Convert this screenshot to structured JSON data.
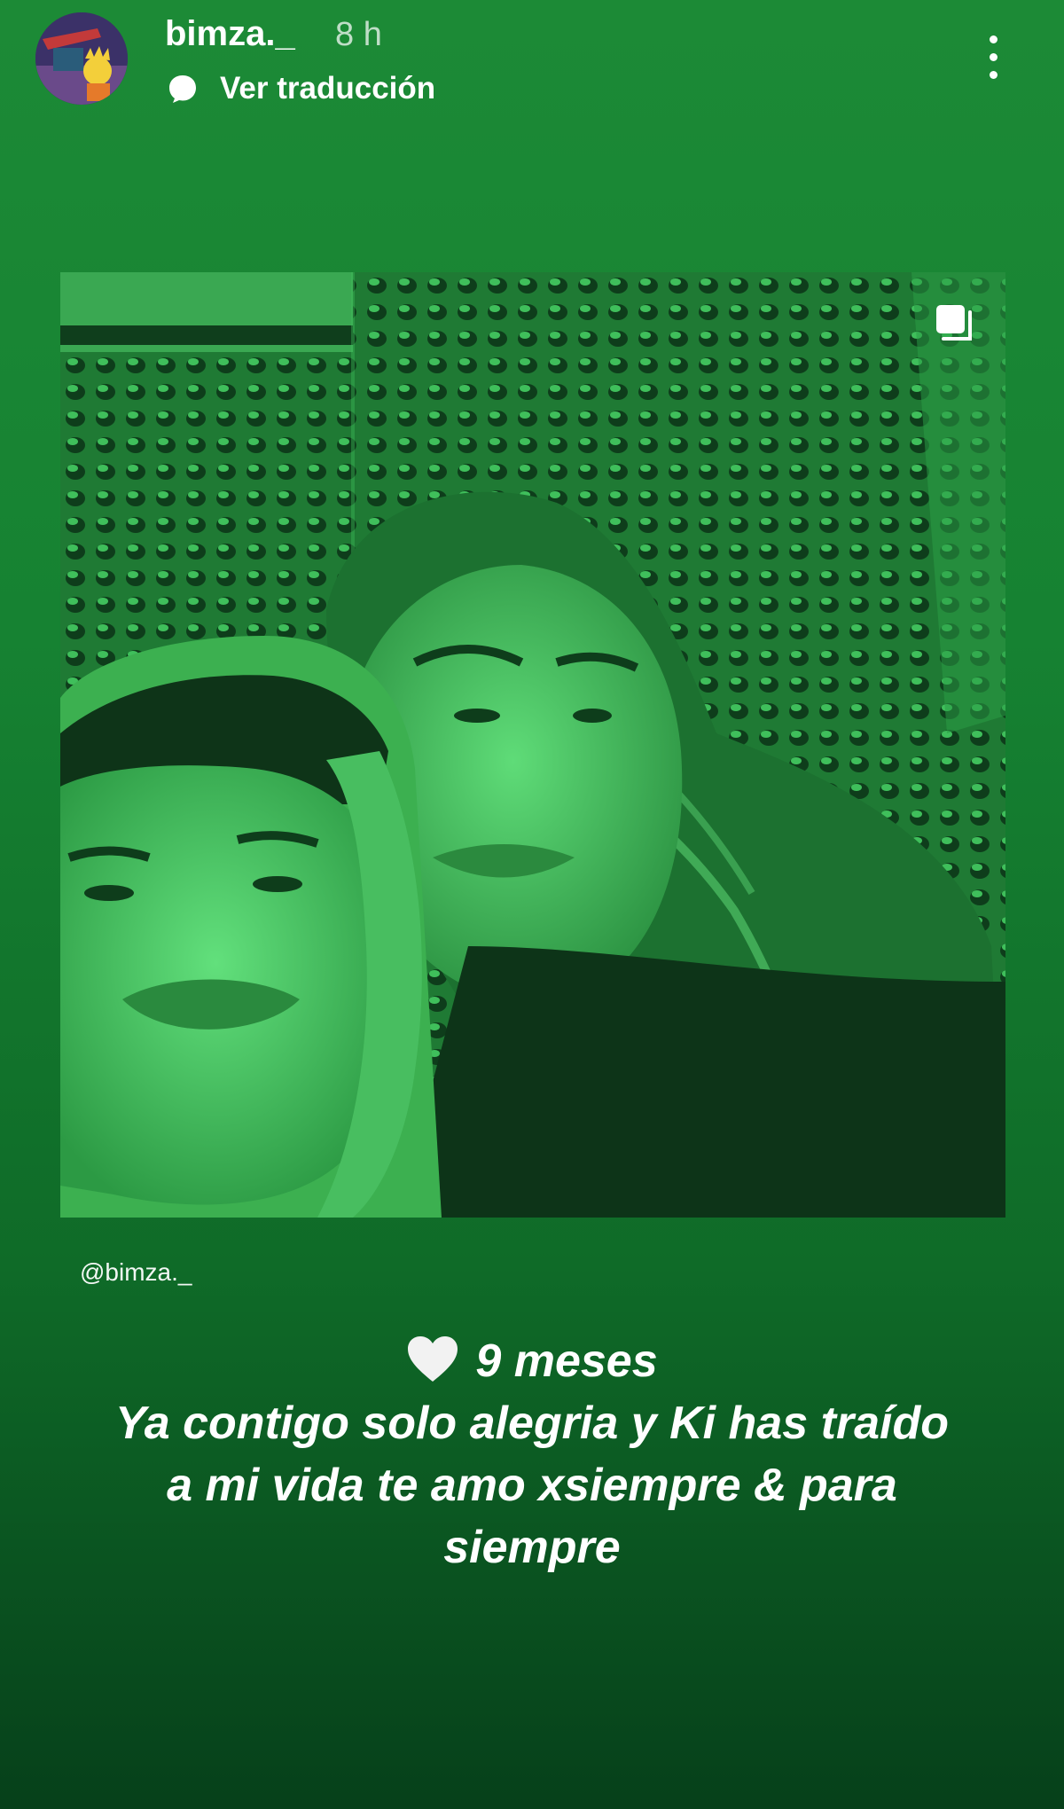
{
  "story": {
    "username": "bimza._",
    "time": "8 h",
    "translate_label": "Ver traducción",
    "mention": "@bimza._"
  },
  "caption": {
    "heart_icon": "white-heart",
    "line1": "9 meses",
    "line2": "Ya contigo solo alegria y Ki has traído",
    "line3": "a mi vida te amo xsiempre & para",
    "line4": "siempre"
  },
  "colors": {
    "background_top": "#1c8a36",
    "background_bottom": "#06401a",
    "photo_tint": "#2fa84a"
  }
}
